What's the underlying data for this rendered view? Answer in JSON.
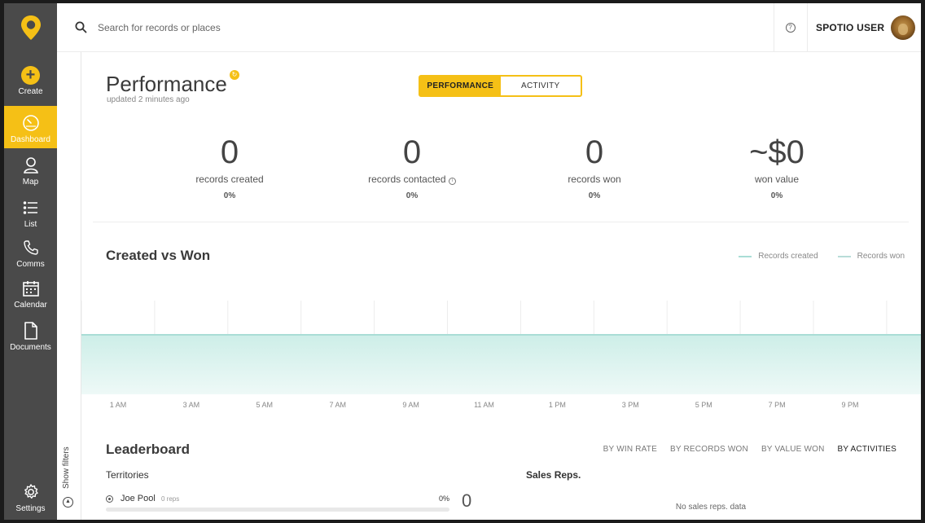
{
  "sidebar": {
    "logo_icon": "spotio-pin-logo",
    "items": [
      {
        "label": "Create",
        "icon": "plus-circle-icon"
      },
      {
        "label": "Dashboard",
        "icon": "gauge-icon",
        "active": true
      },
      {
        "label": "Map",
        "icon": "map-pin-person-icon"
      },
      {
        "label": "List",
        "icon": "list-icon"
      },
      {
        "label": "Comms",
        "icon": "phone-icon"
      },
      {
        "label": "Calendar",
        "icon": "calendar-icon"
      },
      {
        "label": "Documents",
        "icon": "document-icon"
      }
    ],
    "settings_label": "Settings",
    "show_filters_label": "Show filters"
  },
  "topbar": {
    "search_placeholder": "Search for records or places",
    "search_value": "",
    "help_icon": "question-circle-icon",
    "user_name": "SPOTIO USER"
  },
  "performance": {
    "title": "Performance",
    "updated": "updated 2 minutes ago",
    "toggle": {
      "performance": "PERFORMANCE",
      "activity": "ACTIVITY",
      "selected": "performance"
    }
  },
  "stats": [
    {
      "value": "0",
      "label": "records created",
      "pct": "0%",
      "info": false
    },
    {
      "value": "0",
      "label": "records contacted",
      "pct": "0%",
      "info": true
    },
    {
      "value": "0",
      "label": "records won",
      "pct": "0%",
      "info": false
    },
    {
      "value": "~$0",
      "label": "won value",
      "pct": "0%",
      "info": false
    }
  ],
  "created_vs_won": {
    "title": "Created vs Won",
    "legend": [
      {
        "label": "Records created",
        "color": "#a9ddd6"
      },
      {
        "label": "Records won",
        "color": "#b8dcd8"
      }
    ]
  },
  "chart_data": {
    "type": "area",
    "x": [
      "1 AM",
      "3 AM",
      "5 AM",
      "7 AM",
      "9 AM",
      "11 AM",
      "1 PM",
      "3 PM",
      "5 PM",
      "7 PM",
      "9 PM"
    ],
    "series": [
      {
        "name": "Records created",
        "values": [
          0,
          0,
          0,
          0,
          0,
          0,
          0,
          0,
          0,
          0,
          0
        ]
      },
      {
        "name": "Records won",
        "values": [
          0,
          0,
          0,
          0,
          0,
          0,
          0,
          0,
          0,
          0,
          0
        ]
      }
    ],
    "fill_color": "#d6f0ec",
    "line_color": "#a9ddd6",
    "grid": true
  },
  "leaderboard": {
    "title": "Leaderboard",
    "tabs": [
      {
        "label": "BY WIN RATE",
        "active": false
      },
      {
        "label": "BY RECORDS WON",
        "active": false
      },
      {
        "label": "BY VALUE WON",
        "active": false
      },
      {
        "label": "BY ACTIVITIES",
        "active": true
      }
    ],
    "territories_heading": "Territories",
    "sales_reps_heading": "Sales Reps.",
    "territories": [
      {
        "name": "Joe Pool",
        "reps": "0 reps",
        "pct": "0%",
        "fill": 0
      }
    ],
    "territory_count": "0",
    "no_reps_text": "No sales reps. data"
  }
}
